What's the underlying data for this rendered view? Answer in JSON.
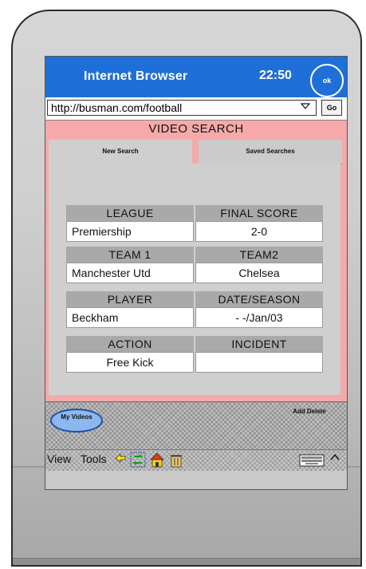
{
  "browser": {
    "title": "Internet Browser",
    "time": "22:50",
    "ok_label": "ok",
    "url": "http://busman.com/football",
    "go_label": "Go"
  },
  "page": {
    "heading": "VIDEO SEARCH",
    "tabs": [
      {
        "label": "New Search",
        "active": true
      },
      {
        "label": "Saved Searches",
        "active": false
      }
    ],
    "fields": {
      "league": {
        "label": "LEAGUE",
        "value": "Premiership"
      },
      "final_score": {
        "label": "FINAL SCORE",
        "value": "2-0"
      },
      "team1": {
        "label": "TEAM 1",
        "value": "Manchester Utd"
      },
      "team2": {
        "label": "TEAM2",
        "value": "Chelsea"
      },
      "player": {
        "label": "PLAYER",
        "value": "Beckham"
      },
      "date_season": {
        "label": "DATE/SEASON",
        "value": "- -/Jan/03"
      },
      "action": {
        "label": "ACTION",
        "value": "Free Kick"
      },
      "incident": {
        "label": "INCIDENT",
        "value": ""
      }
    }
  },
  "footer": {
    "my_videos": "My Videos",
    "add_delete": "Add Delete"
  },
  "toolbar": {
    "view": "View",
    "tools": "Tools"
  },
  "colors": {
    "titlebar": "#1f6fd8",
    "content_bg": "#f5a9a9",
    "panel_bg": "#cfcfcf",
    "label_bg": "#a9a9a9",
    "my_videos_fill": "#8db8ee"
  },
  "icons": [
    "ok-icon",
    "dropdown-arrow-icon",
    "back-arrow-icon",
    "refresh-icon",
    "home-icon",
    "trash-icon",
    "keyboard-icon",
    "scroll-up-caret-icon"
  ]
}
